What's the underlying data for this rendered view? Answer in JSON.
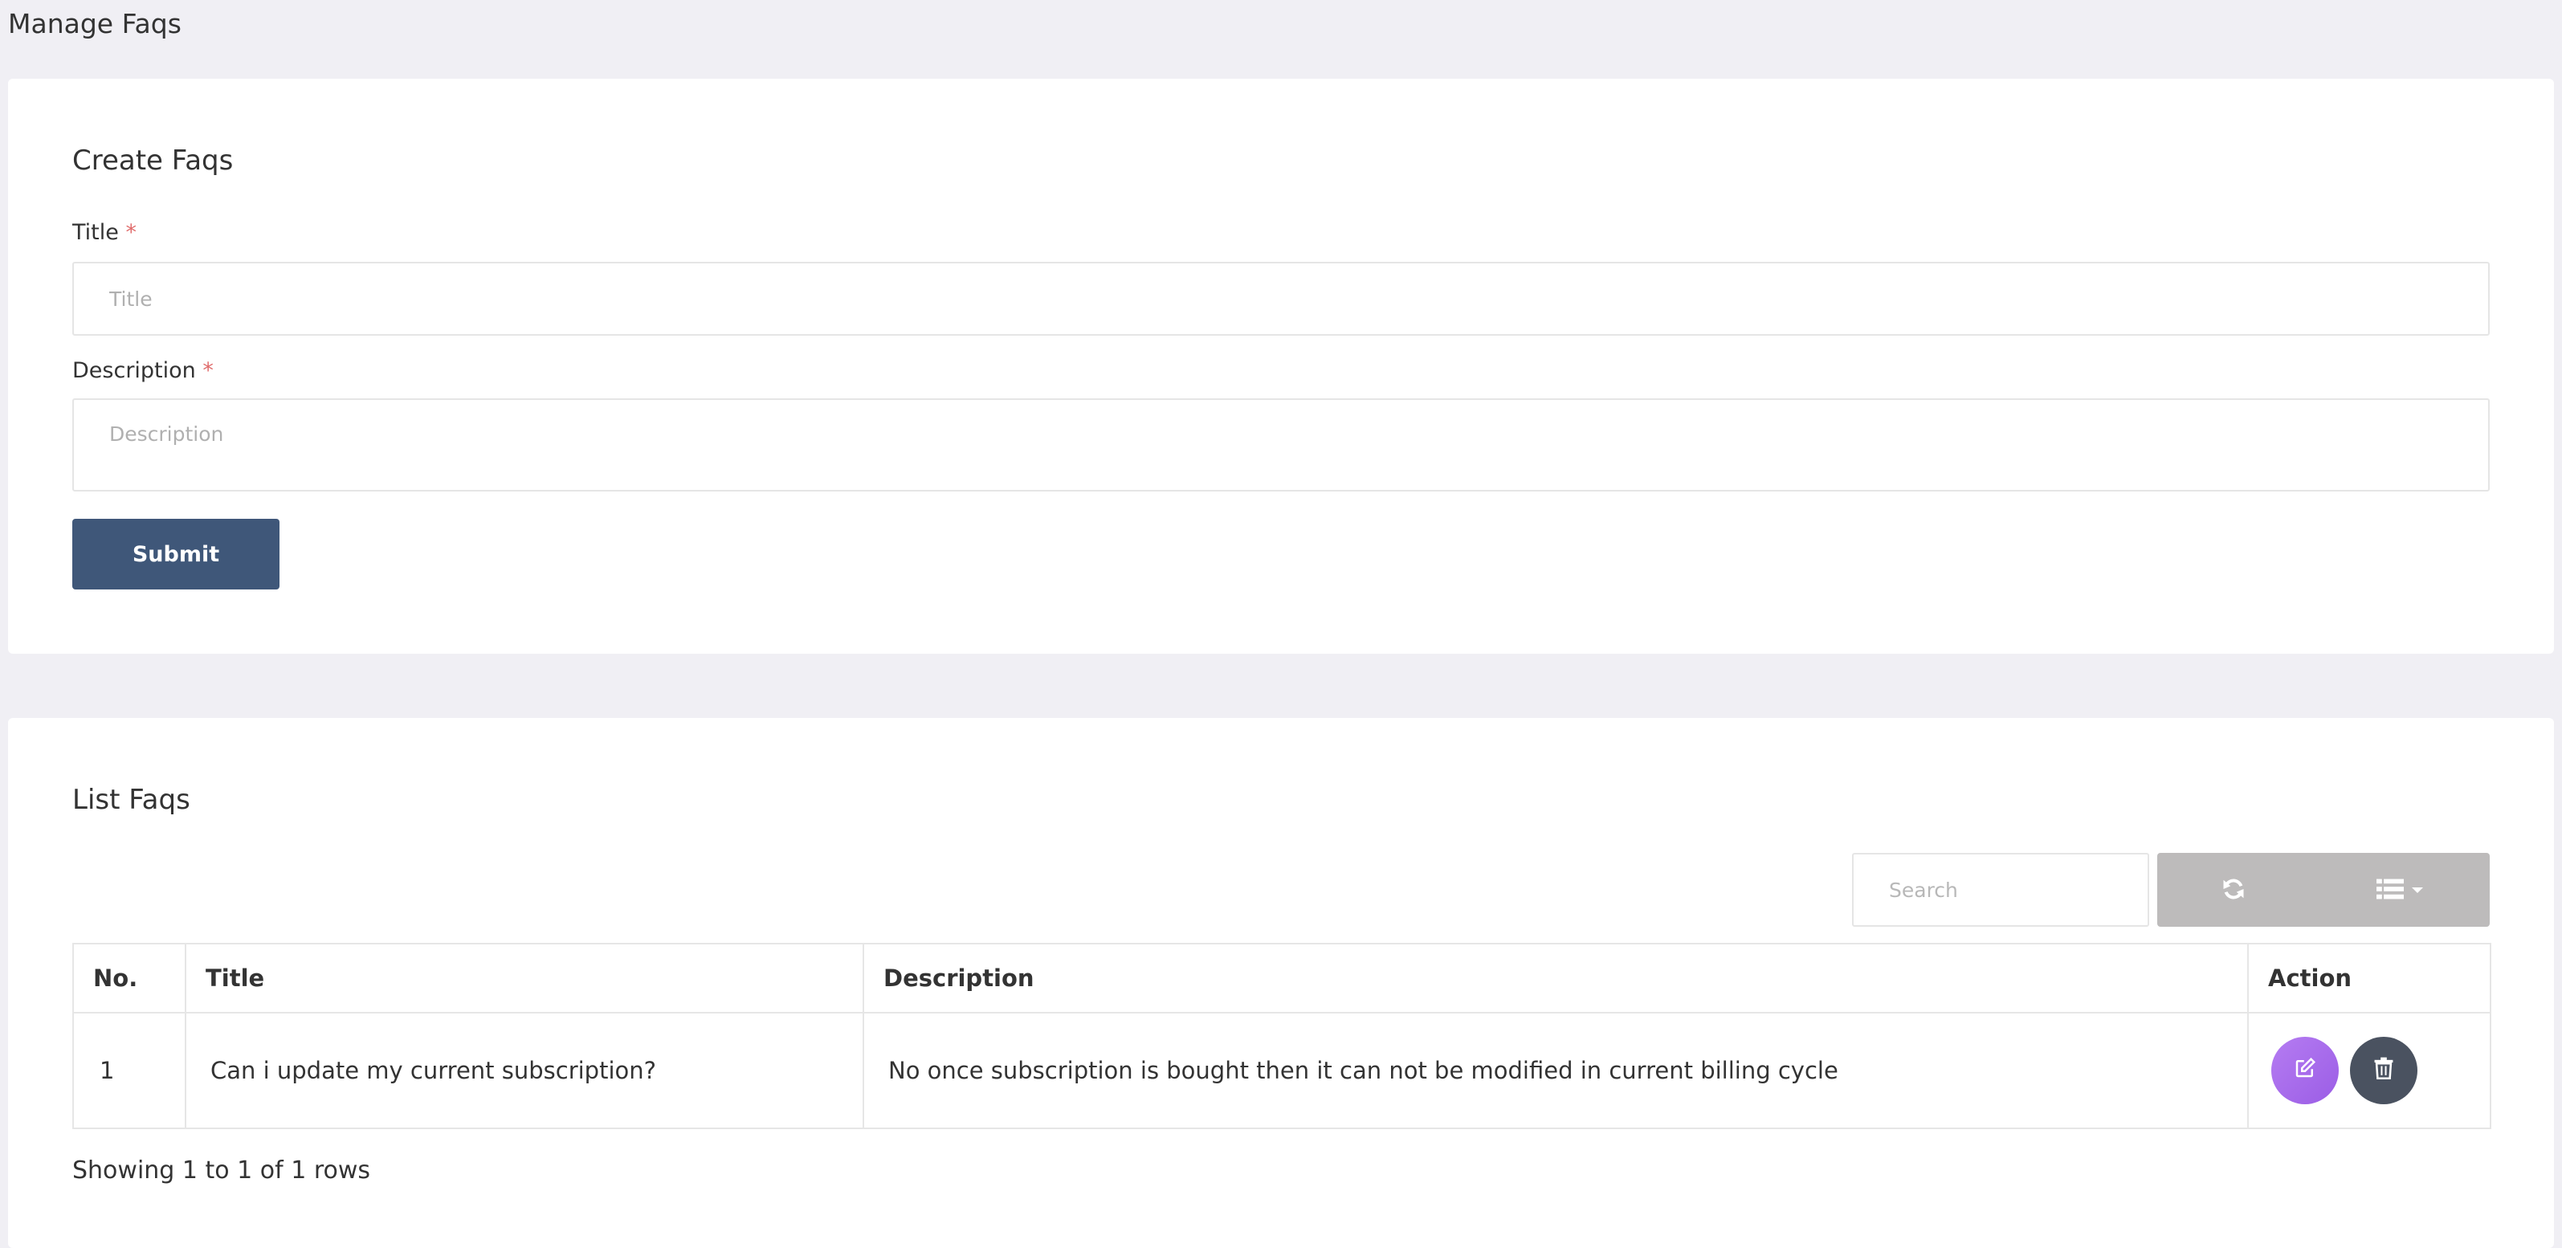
{
  "page": {
    "title": "Manage Faqs"
  },
  "create": {
    "title": "Create Faqs",
    "title_label": "Title",
    "title_placeholder": "Title",
    "description_label": "Description",
    "description_placeholder": "Description",
    "required_mark": "*",
    "submit_label": "Submit"
  },
  "list": {
    "title": "List Faqs",
    "search_placeholder": "Search",
    "columns": [
      "No.",
      "Title",
      "Description",
      "Action"
    ],
    "rows": [
      {
        "no": "1",
        "title": "Can i update my current subscription?",
        "description": "No once subscription is bought then it can not be modified in current billing cycle"
      }
    ],
    "footer": "Showing 1 to 1 of 1 rows"
  },
  "icons": {
    "refresh": "refresh-icon",
    "columns": "list-icon",
    "edit": "edit-icon",
    "delete": "trash-icon"
  },
  "colors": {
    "background": "#f0eff4",
    "submit": "#3f5779",
    "toolbar": "#bdbbbb",
    "edit": "#a56ced",
    "delete": "#4a5260",
    "required": "#e06c6c"
  }
}
